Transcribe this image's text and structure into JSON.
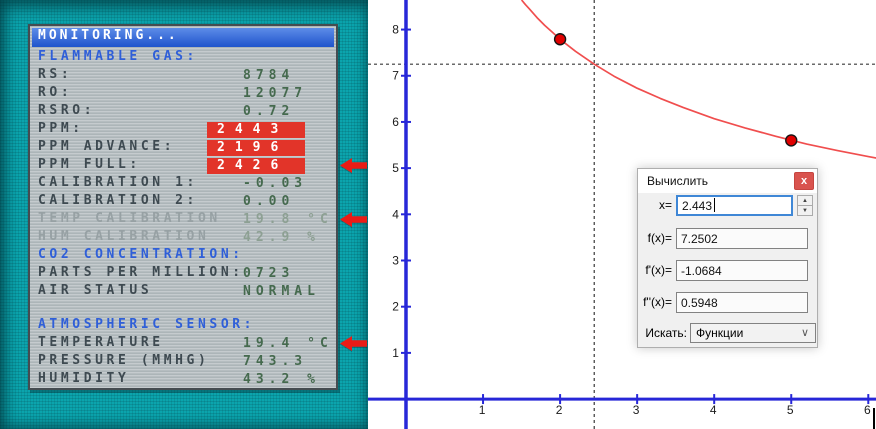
{
  "lcd": {
    "title": "MONITORING...",
    "arrow_color": "#ea1c16",
    "alert_bg": "#e23429",
    "rows": [
      {
        "type": "section",
        "label": "FLAMMABLE GAS:"
      },
      {
        "type": "normal",
        "label": "RS:",
        "value": "8784"
      },
      {
        "type": "normal",
        "label": "RO:",
        "value": "12077"
      },
      {
        "type": "normal",
        "label": "RSRO:",
        "value": "0.72"
      },
      {
        "type": "alert",
        "label": "PPM:",
        "value": "2443"
      },
      {
        "type": "alert",
        "label": "PPM ADVANCE:",
        "value": "2196"
      },
      {
        "type": "alert",
        "label": "PPM FULL:",
        "value": "2426",
        "arrow": true
      },
      {
        "type": "normal",
        "label": "CALIBRATION 1:",
        "value": "-0.03"
      },
      {
        "type": "normal",
        "label": "CALIBRATION 2:",
        "value": "0.00"
      },
      {
        "type": "dim",
        "label": "TEMP CALIBRATION",
        "value": "19.8 °C",
        "arrow": true
      },
      {
        "type": "dim",
        "label": "HUM CALIBRATION",
        "value": "42.9 %"
      },
      {
        "type": "section",
        "label": "CO2 CONCENTRATION:"
      },
      {
        "type": "normal",
        "label": "PARTS PER MILLION:",
        "value": "0723"
      },
      {
        "type": "normal",
        "label": "AIR STATUS",
        "value": "NORMAL"
      },
      {
        "type": "blank"
      },
      {
        "type": "section",
        "label": "ATMOSPHERIC SENSOR:"
      },
      {
        "type": "normal",
        "label": "TEMPERATURE",
        "value": "19.4 °C",
        "arrow": true
      },
      {
        "type": "normal",
        "label": "PRESSURE (MMHG)",
        "value": "743.3"
      },
      {
        "type": "normal",
        "label": "HUMIDITY",
        "value": "43.2 %"
      }
    ]
  },
  "dialog": {
    "title": "Вычислить",
    "close_label": "x",
    "fields": [
      {
        "label": "x=",
        "value": "2.443"
      },
      {
        "label": "f(x)=",
        "value": "7.2502"
      },
      {
        "label": "f'(x)=",
        "value": "-1.0684"
      },
      {
        "label": "f''(x)=",
        "value": "0.5948"
      }
    ],
    "search_label": "Искать:",
    "search_value": "Функции"
  },
  "icons": {
    "spinner_up": "▲",
    "spinner_down": "▼",
    "chevron_down": "∨"
  },
  "chart_data": {
    "type": "line",
    "title": "",
    "xlabel": "",
    "ylabel": "",
    "grid": false,
    "axis_color": "#2727d8",
    "tick_label_color": "#1b1b1b",
    "crosshair_color": "#383838",
    "x_axis": {
      "min": -0.493,
      "max": 6.1,
      "ticks": [
        1,
        2,
        3,
        4,
        5,
        6
      ]
    },
    "y_axis": {
      "min": -0.648,
      "max": 8.64,
      "ticks": [
        1,
        2,
        3,
        4,
        5,
        6,
        7,
        8
      ]
    },
    "series": [
      {
        "name": "f(x)",
        "color": "#f04e4e",
        "samples": [
          [
            1.5,
            8.64
          ],
          [
            1.55,
            8.54
          ],
          [
            1.6,
            8.45
          ],
          [
            1.7,
            8.26
          ],
          [
            1.8,
            8.09
          ],
          [
            1.9,
            7.94
          ],
          [
            2,
            7.79
          ],
          [
            2.2,
            7.53
          ],
          [
            2.443,
            7.25
          ],
          [
            2.7,
            6.99
          ],
          [
            3,
            6.73
          ],
          [
            3.3,
            6.51
          ],
          [
            3.6,
            6.31
          ],
          [
            4,
            6.07
          ],
          [
            4.4,
            5.87
          ],
          [
            4.8,
            5.69
          ],
          [
            5.2,
            5.52
          ],
          [
            5.6,
            5.38
          ],
          [
            6,
            5.25
          ],
          [
            6.2,
            5.19
          ]
        ]
      }
    ],
    "marked_points": {
      "color": "#e00000",
      "stroke": "#151515",
      "points": [
        [
          2,
          7.79
        ],
        [
          5,
          5.6
        ]
      ]
    },
    "crosshair": {
      "x": 2.443,
      "y": 7.2502
    }
  }
}
